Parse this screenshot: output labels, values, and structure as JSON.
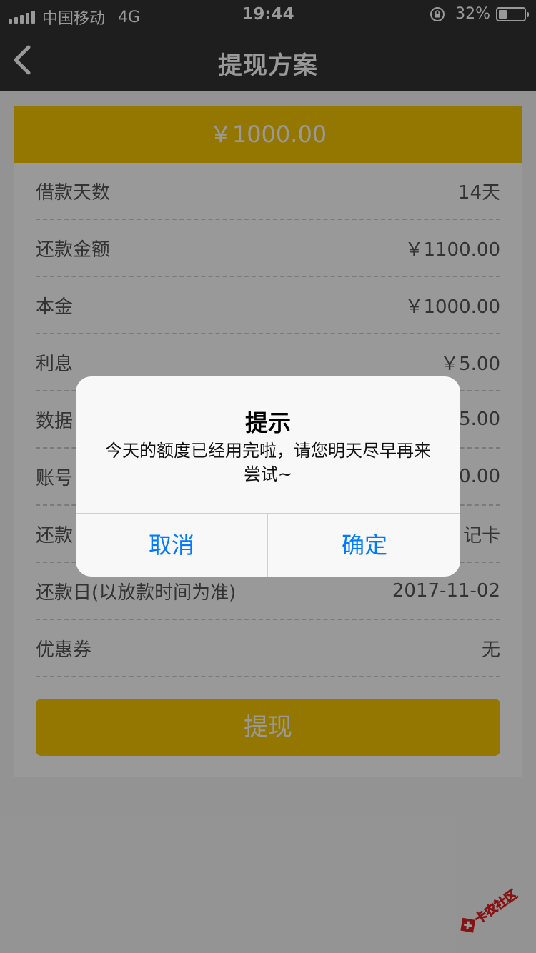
{
  "status_bar": {
    "carrier": "中国移动",
    "network": "4G",
    "time": "19:44",
    "battery_percent": "32%",
    "battery_level": 0.32
  },
  "nav": {
    "title": "提现方案",
    "back_icon": "chevron-left-icon"
  },
  "card": {
    "amount": "￥1000.00",
    "rows": [
      {
        "label": "借款天数",
        "value": "14天"
      },
      {
        "label": "还款金额",
        "value": "￥1100.00"
      },
      {
        "label": "本金",
        "value": "￥1000.00"
      },
      {
        "label": "利息",
        "value": "￥5.00"
      },
      {
        "label": "数据",
        "value": "5.00"
      },
      {
        "label": "账号",
        "value": "0.00"
      },
      {
        "label": "还款",
        "value": "记卡"
      },
      {
        "label": "还款日(以放款时间为准)",
        "value": "2017-11-02"
      },
      {
        "label": "优惠券",
        "value": "无"
      }
    ],
    "withdraw_label": "提现"
  },
  "alert": {
    "title": "提示",
    "message": "今天的额度已经用完啦，请您明天尽早再来尝试~",
    "cancel_label": "取消",
    "confirm_label": "确定"
  },
  "watermark": {
    "text": "卡农社区"
  },
  "colors": {
    "bar": "#333333",
    "accent": "#f5c600",
    "link": "#007aff"
  }
}
